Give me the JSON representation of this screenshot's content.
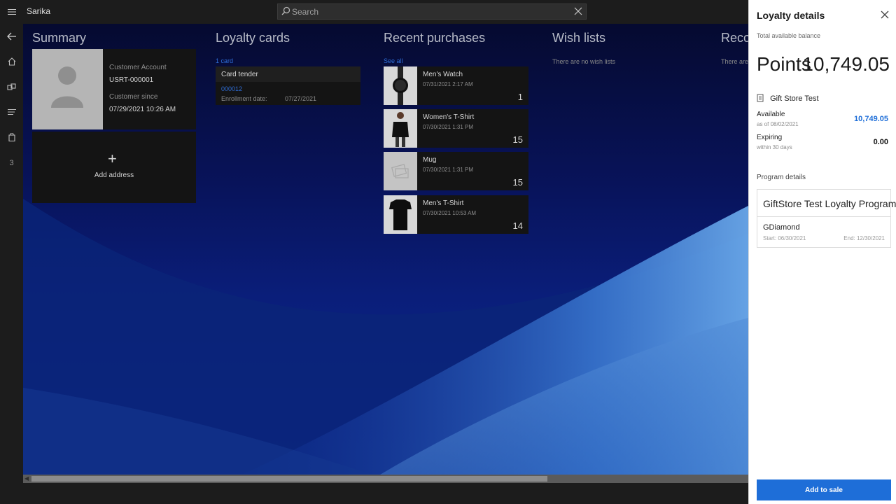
{
  "app": {
    "title": "Sarika"
  },
  "search": {
    "placeholder": "Search"
  },
  "rail": {
    "cart_count": "3"
  },
  "summary": {
    "title": "Summary",
    "account_label": "Customer Account",
    "account_value": "USRT-000001",
    "since_label": "Customer since",
    "since_value": "07/29/2021 10:26 AM",
    "add_address": "Add address"
  },
  "loyalty_cards": {
    "title": "Loyalty cards",
    "count_link": "1 card",
    "card_tender": "Card tender",
    "card_number": "000012",
    "enroll_label": "Enrollment date:",
    "enroll_value": "07/27/2021"
  },
  "recent_purchases": {
    "title": "Recent purchases",
    "see_all": "See all",
    "items": [
      {
        "name": "Men's Watch",
        "date": "07/31/2021 2:17 AM",
        "qty": "1",
        "image": "watch"
      },
      {
        "name": "Women's T-Shirt",
        "date": "07/30/2021 1:31 PM",
        "qty": "15",
        "image": "womens-tshirt"
      },
      {
        "name": "Mug",
        "date": "07/30/2021 1:31 PM",
        "qty": "15",
        "image": "placeholder-image"
      },
      {
        "name": "Men's T-Shirt",
        "date": "07/30/2021 10:53 AM",
        "qty": "14",
        "image": "mens-tshirt"
      }
    ]
  },
  "wish_lists": {
    "title": "Wish lists",
    "empty": "There are no wish lists"
  },
  "recommended": {
    "title": "Recon",
    "empty": "There are"
  },
  "loyalty_panel": {
    "title": "Loyalty details",
    "subtitle": "Total available balance",
    "points_label": "Points",
    "points_value": "10,749.05",
    "store_name": "Gift Store Test",
    "available_label": "Available",
    "available_asof": "as of 08/02/2021",
    "available_value": "10,749.05",
    "expiring_label": "Expiring",
    "expiring_within": "within 30 days",
    "expiring_value": "0.00",
    "program_details_label": "Program details",
    "program_name": "GiftStore Test Loyalty Program",
    "tier_name": "GDiamond",
    "tier_start": "Start: 06/30/2021",
    "tier_end": "End: 12/30/2021",
    "add_to_sale": "Add to sale"
  },
  "colors": {
    "accent": "#1e6ed8",
    "link": "#2f6ed8",
    "available_value": "#1e6ed8"
  }
}
